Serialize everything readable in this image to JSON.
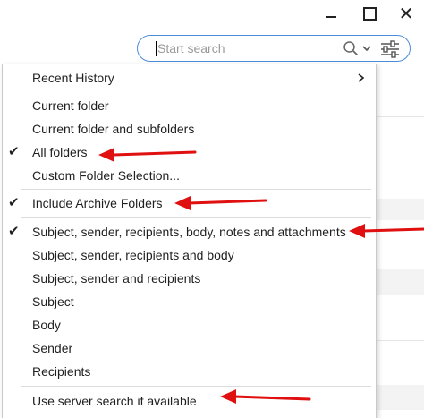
{
  "window": {
    "minimize_icon": "minimize-icon",
    "maximize_icon": "maximize-icon",
    "close_glyph": "✕"
  },
  "search": {
    "placeholder": "Start search",
    "value": "",
    "search_icon": "search-icon",
    "dropdown_icon": "chevron-down-icon",
    "filter_icon": "filter-sliders-icon",
    "accent_color": "#4b8ed8"
  },
  "menu": {
    "recent_history": "Recent History",
    "scope_items": [
      {
        "label": "Current folder",
        "checked": false
      },
      {
        "label": "Current folder and subfolders",
        "checked": false
      },
      {
        "label": "All folders",
        "checked": true
      },
      {
        "label": "Custom Folder Selection...",
        "checked": false
      }
    ],
    "archive_item": {
      "label": "Include Archive Folders",
      "checked": true
    },
    "field_items": [
      {
        "label": "Subject, sender, recipients, body, notes and attachments",
        "checked": true
      },
      {
        "label": "Subject, sender, recipients and body",
        "checked": false
      },
      {
        "label": "Subject, sender and recipients",
        "checked": false
      },
      {
        "label": "Subject",
        "checked": false
      },
      {
        "label": "Body",
        "checked": false
      },
      {
        "label": "Sender",
        "checked": false
      },
      {
        "label": "Recipients",
        "checked": false
      }
    ],
    "server_item": {
      "label": "Use server search if available",
      "checked": false
    },
    "check_glyph": "✔"
  },
  "annotations": {
    "arrow_color": "#e01010"
  }
}
